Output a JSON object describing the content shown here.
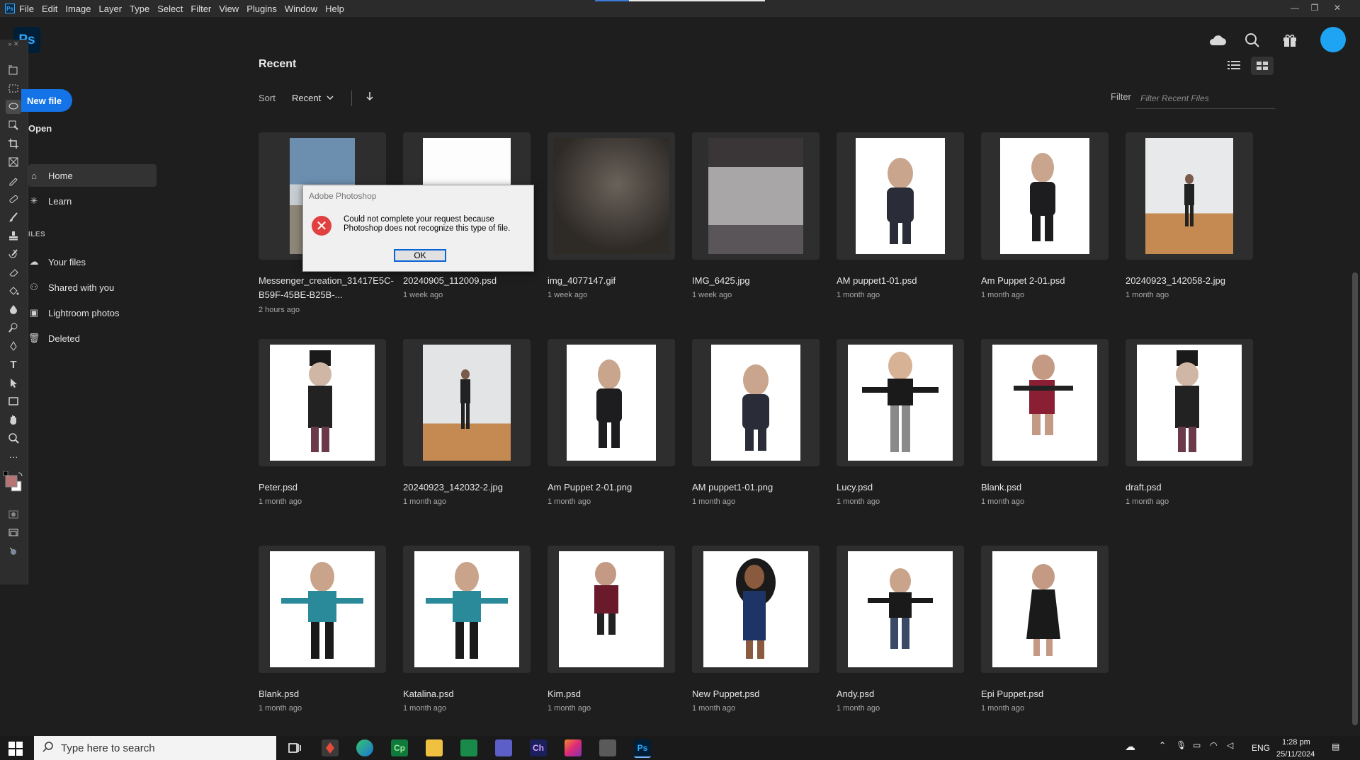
{
  "menu": {
    "app_icon": "Ps",
    "items": [
      "File",
      "Edit",
      "Image",
      "Layer",
      "Type",
      "Select",
      "Filter",
      "View",
      "Plugins",
      "Window",
      "Help"
    ]
  },
  "header": {
    "logo": "Ps",
    "icons": [
      "cloud-icon",
      "search-icon",
      "gift-icon",
      "avatar"
    ]
  },
  "sidebar": {
    "new_file": "New file",
    "open": "Open",
    "home": "Home",
    "learn": "Learn",
    "section_files": "ILES",
    "your_files": "Your files",
    "shared": "Shared with you",
    "lightroom": "Lightroom photos",
    "deleted": "Deleted"
  },
  "main": {
    "title": "Recent",
    "sort_label": "Sort",
    "sort_value": "Recent",
    "filter_label": "Filter",
    "filter_placeholder": "Filter Recent Files"
  },
  "files": [
    {
      "name": "Messenger_creation_31417E5C-B59F-45BE-B25B-...",
      "date": "2 hours ago"
    },
    {
      "name": "20240905_112009.psd",
      "date": "1 week ago"
    },
    {
      "name": "img_4077147.gif",
      "date": "1 week ago"
    },
    {
      "name": "IMG_6425.jpg",
      "date": "1 week ago"
    },
    {
      "name": "AM puppet1-01.psd",
      "date": "1 month ago"
    },
    {
      "name": "Am Puppet 2-01.psd",
      "date": "1 month ago"
    },
    {
      "name": "20240923_142058-2.jpg",
      "date": "1 month ago"
    },
    {
      "name": "Peter.psd",
      "date": "1 month ago"
    },
    {
      "name": "20240923_142032-2.jpg",
      "date": "1 month ago"
    },
    {
      "name": "Am Puppet 2-01.png",
      "date": "1 month ago"
    },
    {
      "name": "AM puppet1-01.png",
      "date": "1 month ago"
    },
    {
      "name": "Lucy.psd",
      "date": "1 month ago"
    },
    {
      "name": "Blank.psd",
      "date": "1 month ago"
    },
    {
      "name": "draft.psd",
      "date": "1 month ago"
    },
    {
      "name": "Blank.psd",
      "date": "1 month ago"
    },
    {
      "name": "Katalina.psd",
      "date": "1 month ago"
    },
    {
      "name": "Kim.psd",
      "date": "1 month ago"
    },
    {
      "name": "New Puppet.psd",
      "date": "1 month ago"
    },
    {
      "name": "Andy.psd",
      "date": "1 month ago"
    },
    {
      "name": "Epi Puppet.psd",
      "date": "1 month ago"
    }
  ],
  "dialog": {
    "title": "Adobe Photoshop",
    "message": "Could not complete your request because Photoshop does not recognize this type of file.",
    "ok": "OK"
  },
  "taskbar": {
    "search_placeholder": "Type here to search",
    "lang": "ENG",
    "time": "1:28 pm",
    "date": "25/11/2024",
    "apps": [
      "Cp",
      "Ch",
      "Ps"
    ]
  }
}
